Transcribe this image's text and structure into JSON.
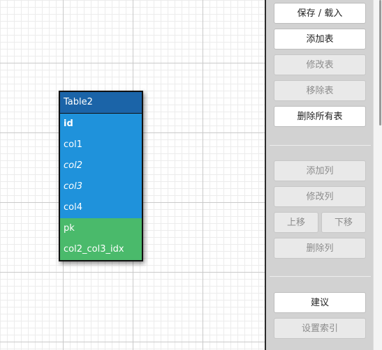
{
  "table": {
    "title": "Table2",
    "columns": [
      {
        "name": "id",
        "style": "primary-key"
      },
      {
        "name": "col1",
        "style": "normal"
      },
      {
        "name": "col2",
        "style": "italic"
      },
      {
        "name": "col3",
        "style": "italic"
      },
      {
        "name": "col4",
        "style": "normal"
      }
    ],
    "indexes": [
      "pk",
      "col2_col3_idx"
    ]
  },
  "panel": {
    "save_load": "保存 / 载入",
    "add_table": "添加表",
    "edit_table": "修改表",
    "remove_table": "移除表",
    "remove_all_tables": "删除所有表",
    "add_column": "添加列",
    "edit_column": "修改列",
    "move_up": "上移",
    "move_down": "下移",
    "remove_column": "删除列",
    "suggest": "建议",
    "set_index": "设置索引"
  },
  "colors": {
    "table_header": "#1b64a8",
    "column_row": "#1f92db",
    "index_row": "#4aba6b",
    "panel_bg": "#d2d2d2"
  }
}
